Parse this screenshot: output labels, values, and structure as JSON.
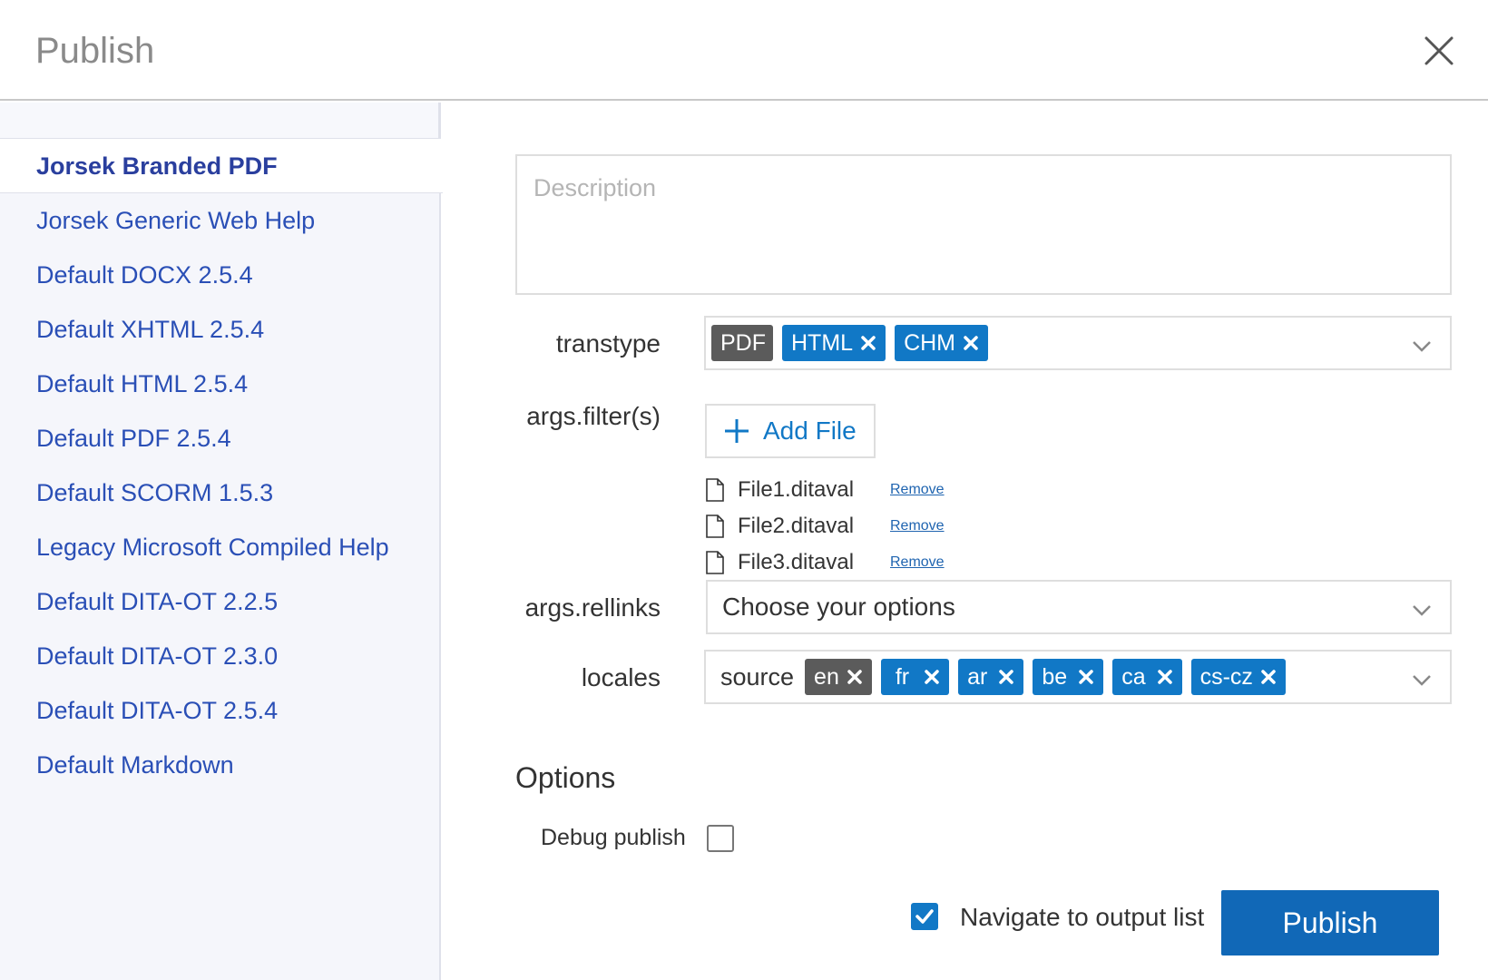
{
  "dialog": {
    "title": "Publish"
  },
  "sidebar": {
    "items": [
      {
        "label": "Jorsek Branded PDF",
        "active": true
      },
      {
        "label": "Jorsek Generic Web Help"
      },
      {
        "label": "Default DOCX 2.5.4"
      },
      {
        "label": "Default XHTML 2.5.4"
      },
      {
        "label": "Default HTML 2.5.4"
      },
      {
        "label": "Default PDF 2.5.4"
      },
      {
        "label": "Default SCORM 1.5.3"
      },
      {
        "label": "Legacy Microsoft Compiled Help"
      },
      {
        "label": "Default DITA-OT 2.2.5"
      },
      {
        "label": "Default DITA-OT 2.3.0"
      },
      {
        "label": "Default DITA-OT 2.5.4"
      },
      {
        "label": "Default Markdown"
      }
    ]
  },
  "form": {
    "description_placeholder": "Description",
    "transtype": {
      "label": "transtype",
      "chips": [
        {
          "label": "PDF",
          "style": "grey",
          "removable": false
        },
        {
          "label": "HTML",
          "style": "blue",
          "removable": true
        },
        {
          "label": "CHM",
          "style": "blue",
          "removable": true
        }
      ]
    },
    "filters": {
      "label": "args.filter(s)",
      "add_file_label": "Add File",
      "remove_label": "Remove",
      "files": [
        "File1.ditaval",
        "File2.ditaval",
        "File3.ditaval"
      ]
    },
    "rellinks": {
      "label": "args.rellinks",
      "value": "Choose your options"
    },
    "locales": {
      "label": "locales",
      "source_label": "source",
      "chips": [
        {
          "label": "en",
          "style": "grey",
          "removable": true
        },
        {
          "label": "fr",
          "style": "blue",
          "removable": true
        },
        {
          "label": "ar",
          "style": "blue",
          "removable": true
        },
        {
          "label": "be",
          "style": "blue",
          "removable": true
        },
        {
          "label": "ca",
          "style": "blue",
          "removable": true
        },
        {
          "label": "cs-cz",
          "style": "blue",
          "removable": true
        }
      ]
    }
  },
  "options": {
    "heading": "Options",
    "debug_label": "Debug publish",
    "debug_checked": false,
    "navigate_label": "Navigate to output list",
    "navigate_checked": true
  },
  "actions": {
    "publish_label": "Publish"
  },
  "colors": {
    "accent": "#1178c6",
    "primary_button": "#1168b7",
    "link": "#2a4fb6",
    "grey_chip": "#5b5b5b"
  },
  "icons": {
    "close": "close-icon",
    "chevron": "chevron-down-icon",
    "chip_remove": "remove-x-icon",
    "add": "plus-icon",
    "file": "file-icon",
    "check": "checkmark-icon"
  }
}
